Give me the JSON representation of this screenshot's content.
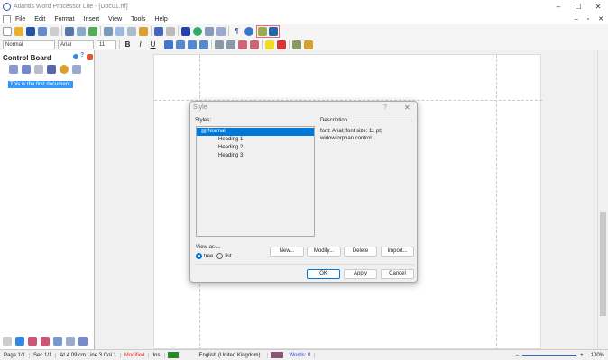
{
  "window": {
    "title": "Atlantis Word Processor Lite - [Doc01.rtf]",
    "controls": [
      "–",
      "☐",
      "✕"
    ],
    "doc_controls": [
      "–",
      "▫",
      "✕"
    ]
  },
  "menu": [
    "File",
    "Edit",
    "Format",
    "Insert",
    "View",
    "Tools",
    "Help"
  ],
  "format_bar": {
    "style": "Normal",
    "font": "Arial",
    "size": "11",
    "bold": "B",
    "italic": "I",
    "underline": "U"
  },
  "control_board": {
    "title": "Control Board",
    "document_item": "This is the first document."
  },
  "dialog": {
    "title": "Style",
    "help": "?",
    "close": "✕",
    "styles_label": "Styles:",
    "styles": [
      "Normal",
      "Heading 1",
      "Heading 2",
      "Heading 3"
    ],
    "selected": "Normal",
    "description_label": "Description",
    "description": "font: Arial; font size: 11 pt; widow/orphan control",
    "view_as_label": "View as ...",
    "view_options": [
      "tree",
      "list"
    ],
    "view_selected": "tree",
    "buttons": {
      "new": "New...",
      "modify": "Modify...",
      "delete": "Delete",
      "import": "Import...",
      "ok": "OK",
      "apply": "Apply",
      "cancel": "Cancel"
    }
  },
  "status": {
    "page": "Page 1/1",
    "sec": "Sec 1/1",
    "at": "At 4.09 cm",
    "line": "Line 3",
    "col": "Col 1",
    "modified": "Modified",
    "ins": "Ins",
    "language": "English (United Kingdom)",
    "words": "Words: 0",
    "zoom": "100%",
    "zoom_minus": "–",
    "zoom_plus": "+"
  },
  "colors": {
    "accent": "#0078d7",
    "selection": "#3399ff",
    "modified": "#e03030",
    "words": "#3344cc"
  }
}
